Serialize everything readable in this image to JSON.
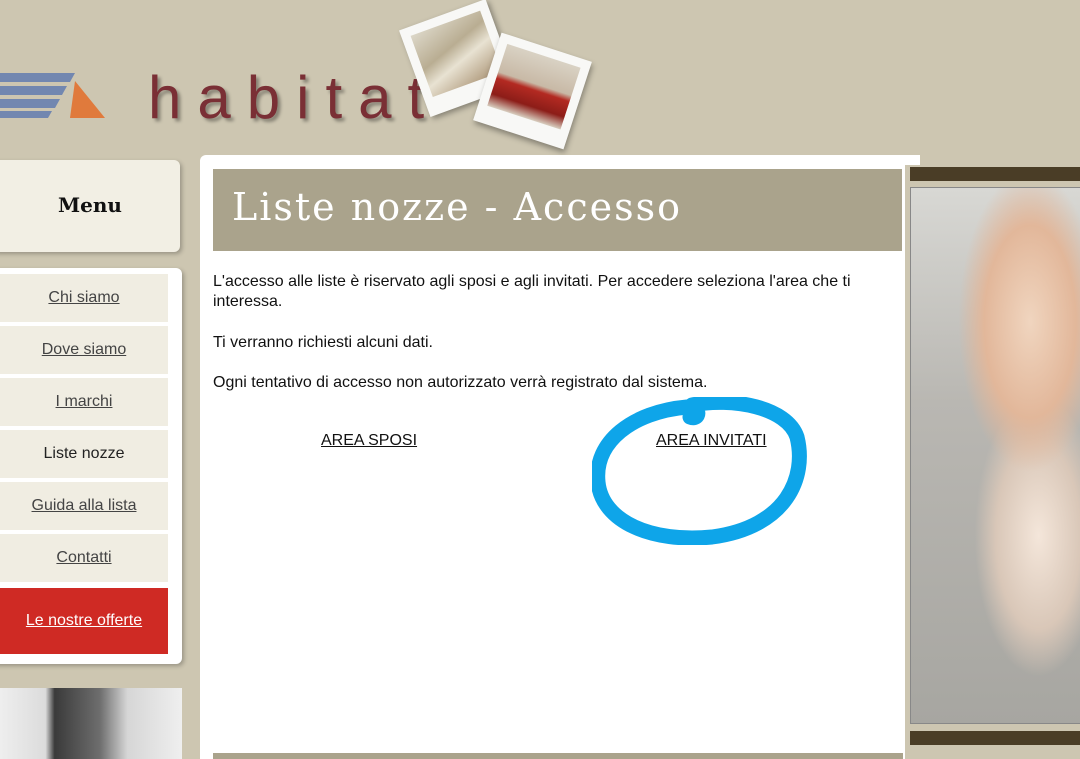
{
  "header": {
    "logo_text": "habitat",
    "colors": {
      "logo_text": "#7a2f35",
      "logo_stripes": "#7287b0",
      "logo_triangle": "#e07a3c"
    }
  },
  "sidebar": {
    "menu_title": "Menu",
    "items": [
      {
        "label": "Chi siamo",
        "current": false
      },
      {
        "label": "Dove siamo",
        "current": false
      },
      {
        "label": "I marchi",
        "current": false
      },
      {
        "label": "Liste nozze",
        "current": true
      },
      {
        "label": "Guida alla lista",
        "current": false
      },
      {
        "label": "Contatti",
        "current": false
      }
    ],
    "offer": {
      "label": "Le nostre offerte",
      "color": "#cf2a24"
    }
  },
  "main": {
    "title": "Liste nozze - Accesso",
    "paragraphs": [
      "L'accesso alle liste è riservato agli sposi e agli invitati. Per accedere seleziona l'area che ti interessa.",
      "Ti verranno richiesti alcuni dati.",
      "Ogni tentativo di accesso non autorizzato verrà registrato dal sistema."
    ],
    "links": {
      "sposi": "AREA SPOSI",
      "invitati": "AREA INVITATI"
    },
    "annotation": {
      "shape": "hand-drawn circle around AREA INVITATI",
      "color": "#0ea5e9"
    }
  }
}
